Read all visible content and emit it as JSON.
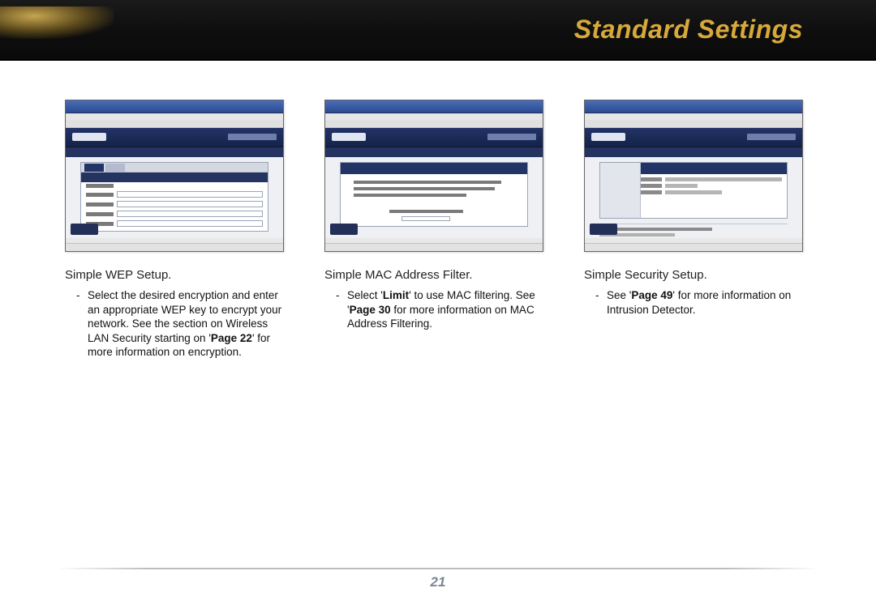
{
  "header": {
    "title": "Standard Settings"
  },
  "columns": [
    {
      "heading": "Simple WEP Setup.",
      "bullet_html": "Select the desired encryption and enter an appropriate WEP key to encrypt your network.  See the section on Wireless LAN Security starting on '<b>Page 22</b>' for more information on encryption."
    },
    {
      "heading": "Simple MAC Address Filter.",
      "bullet_html": "Select '<b>Limit</b>' to use MAC filtering.  See '<b>Page 30</b> for more information on MAC Address Filtering."
    },
    {
      "heading": "Simple Security Setup.",
      "bullet_html": "See '<b>Page 49</b>' for more information on Intrusion Detector."
    }
  ],
  "page_number": "21"
}
